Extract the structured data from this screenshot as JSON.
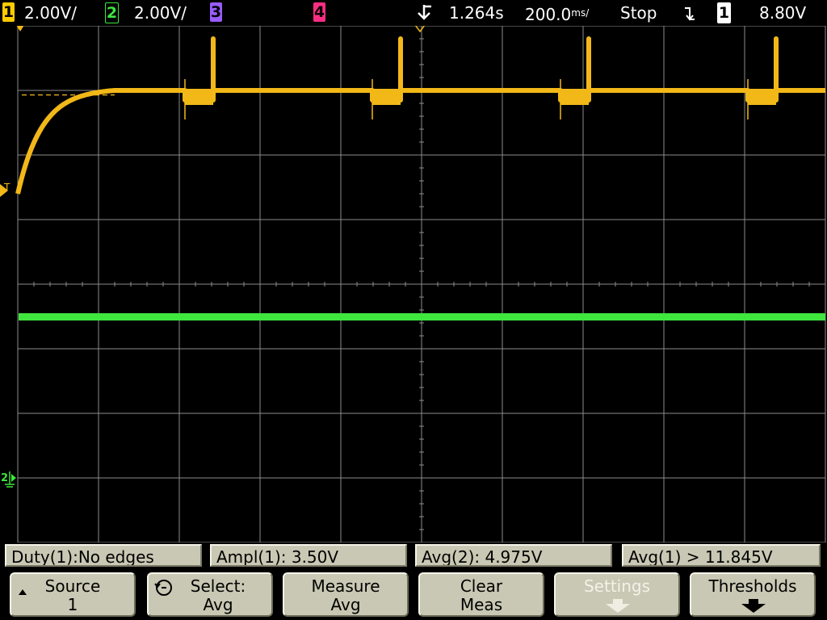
{
  "status": {
    "ch1_label": "1",
    "ch1_scale": "2.00V/",
    "ch2_label": "2",
    "ch2_scale": "2.00V/",
    "ch3_label": "3",
    "ch4_label": "4",
    "trigger_delay": "1.264s",
    "timebase": "200.0",
    "timebase_unit": "ms/",
    "run_state": "Stop",
    "trigger_slope_icon": "falling-edge-icon",
    "trigger_source": "1",
    "trigger_level": "8.80V"
  },
  "markers": {
    "trigger_level_marker": "T",
    "ch2_ground_marker": "2"
  },
  "measurements": [
    {
      "text": "Duty(1):No edges"
    },
    {
      "text": "Ampl(1): 3.50V"
    },
    {
      "text": "Avg(2): 4.975V"
    },
    {
      "text": "Avg(1) > 11.845V"
    }
  ],
  "softkeys": [
    {
      "line1": "Source",
      "line2": "1",
      "icon": "up-arrow-icon",
      "enabled": true
    },
    {
      "line1": "Select:",
      "line2": "Avg",
      "icon": "rotary-knob-icon",
      "enabled": true
    },
    {
      "line1": "Measure",
      "line2": "Avg",
      "icon": "",
      "enabled": true
    },
    {
      "line1": "Clear",
      "line2": "Meas",
      "icon": "",
      "enabled": true
    },
    {
      "line1": "Settings",
      "line2": "",
      "icon": "down-arrow-icon",
      "enabled": false
    },
    {
      "line1": "Thresholds",
      "line2": "",
      "icon": "down-arrow-icon",
      "enabled": true
    }
  ],
  "colors": {
    "channel1": "#f2b818",
    "channel2": "#3ee63e",
    "channel3": "#9a5cff",
    "channel4": "#ff2e82",
    "grid": "#8c8c8c",
    "softkey_face": "#c8c8b4"
  },
  "chart_data": {
    "type": "line",
    "grid": {
      "divisions_x": 10,
      "divisions_y": 8
    },
    "time_per_div_ms": 200.0,
    "volts_per_div": 2.0,
    "series": [
      {
        "name": "1",
        "color": "#f2b818",
        "shape": "exponential rise then plateau with periodic dips",
        "rise": {
          "start_div": [
            0.0,
            5.4
          ],
          "settle_div": [
            1.2,
            7.0
          ]
        },
        "plateau_div": 7.0,
        "dips": [
          {
            "start_div": 2.07,
            "end_div": 2.42,
            "level_div": 6.85,
            "spike_div": 7.8
          },
          {
            "start_div": 4.39,
            "end_div": 4.74,
            "level_div": 6.85,
            "spike_div": 7.8
          },
          {
            "start_div": 6.72,
            "end_div": 7.07,
            "level_div": 6.85,
            "spike_div": 7.8
          },
          {
            "start_div": 9.04,
            "end_div": 9.39,
            "level_div": 6.85,
            "spike_div": 7.8
          }
        ],
        "trigger_reference_div": 6.93
      },
      {
        "name": "2",
        "color": "#3ee63e",
        "shape": "flat noisy line",
        "level_div": 3.5
      }
    ]
  }
}
